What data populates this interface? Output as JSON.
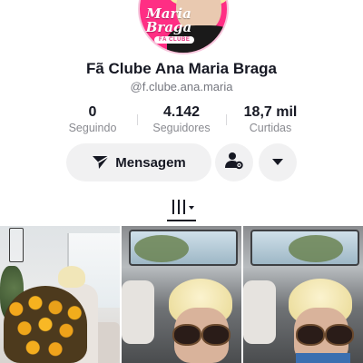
{
  "profile": {
    "avatar_text": "Maria Braga",
    "avatar_badge": "FÃ CLUBE",
    "display_name": "Fã Clube Ana Maria Braga",
    "username": "@f.clube.ana.maria"
  },
  "stats": [
    {
      "value": "0",
      "label": "Seguindo"
    },
    {
      "value": "4.142",
      "label": "Seguidores"
    },
    {
      "value": "18,7 mil",
      "label": "Curtidas"
    }
  ],
  "actions": {
    "message_label": "Mensagem",
    "message_icon": "send-icon",
    "follow_icon": "person-gear-icon",
    "more_icon": "caret-down-icon"
  },
  "tabs": {
    "active": "videos-grid",
    "icon": "grid-lines-icon"
  },
  "colors": {
    "avatar_bg": "#ff2e84",
    "text_primary": "#161823",
    "text_secondary": "#8a8b91",
    "button_bg": "#f1f1f2"
  }
}
